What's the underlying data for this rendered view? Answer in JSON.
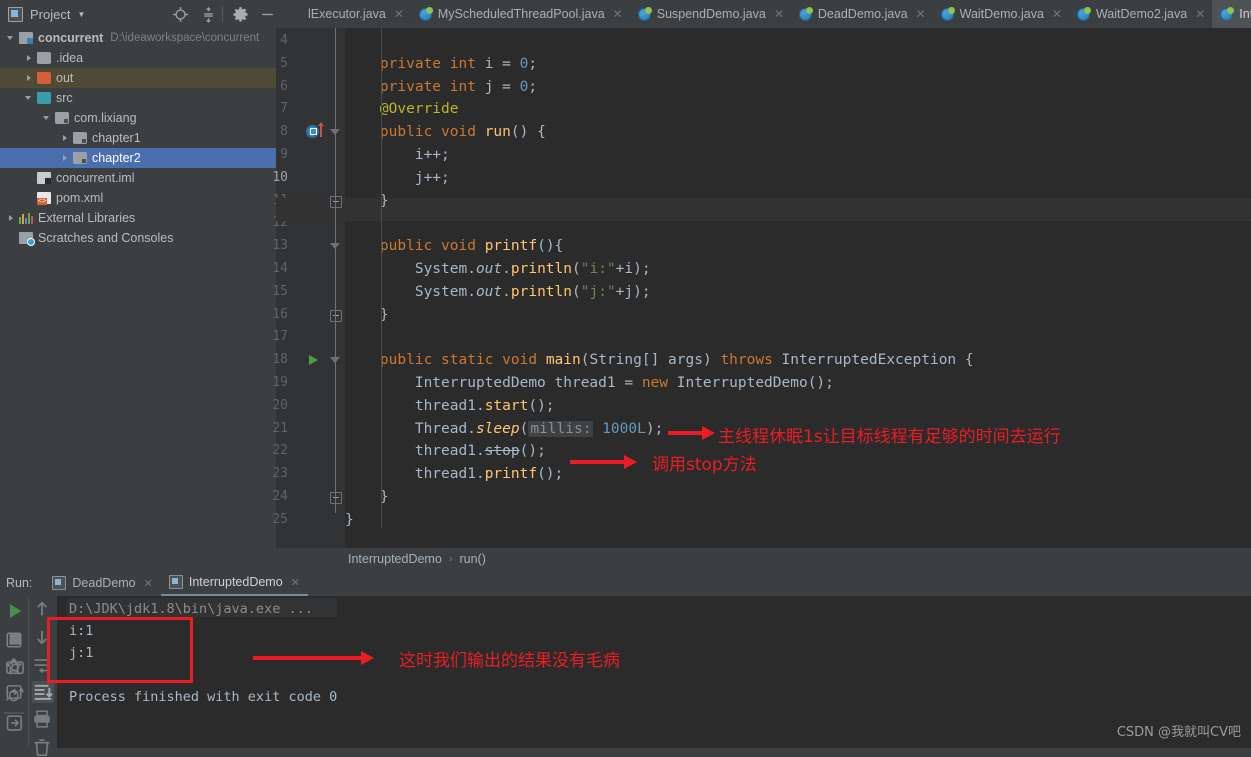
{
  "toolbar": {
    "project_label": "Project",
    "caret": "▼",
    "icons": [
      "locate-icon",
      "collapse-all-icon",
      "settings-gear-icon",
      "hide-icon"
    ]
  },
  "tabs": [
    {
      "label": "lExecutor.java",
      "active": false,
      "icon": "java-class-icon"
    },
    {
      "label": "MyScheduledThreadPool.java",
      "active": false,
      "icon": "java-class-icon"
    },
    {
      "label": "SuspendDemo.java",
      "active": false,
      "icon": "java-class-icon"
    },
    {
      "label": "DeadDemo.java",
      "active": false,
      "icon": "java-class-icon"
    },
    {
      "label": "WaitDemo.java",
      "active": false,
      "icon": "java-class-icon"
    },
    {
      "label": "WaitDemo2.java",
      "active": false,
      "icon": "java-class-icon"
    },
    {
      "label": "Interru",
      "active": true,
      "icon": "java-class-icon"
    }
  ],
  "tree": [
    {
      "label": "concurrent",
      "path": "D:\\ideaworkspace\\concurrent",
      "indent": 0,
      "arrow": "down",
      "icon": "module-icon",
      "state": "normal",
      "bold": true
    },
    {
      "label": ".idea",
      "path": "",
      "indent": 1,
      "arrow": "right",
      "icon": "folder-gray-icon",
      "state": "normal",
      "bold": false
    },
    {
      "label": "out",
      "path": "",
      "indent": 1,
      "arrow": "right",
      "icon": "folder-orange-icon",
      "state": "hover",
      "bold": false
    },
    {
      "label": "src",
      "path": "",
      "indent": 1,
      "arrow": "down",
      "icon": "folder-teal-icon",
      "state": "normal",
      "bold": false
    },
    {
      "label": "com.lixiang",
      "path": "",
      "indent": 2,
      "arrow": "down",
      "icon": "package-icon",
      "state": "normal",
      "bold": false
    },
    {
      "label": "chapter1",
      "path": "",
      "indent": 3,
      "arrow": "right",
      "icon": "package-icon",
      "state": "normal",
      "bold": false
    },
    {
      "label": "chapter2",
      "path": "",
      "indent": 3,
      "arrow": "right",
      "icon": "package-icon",
      "state": "selected",
      "bold": false
    },
    {
      "label": "concurrent.iml",
      "path": "",
      "indent": 1,
      "arrow": "none",
      "icon": "iml-file-icon",
      "state": "normal",
      "bold": false
    },
    {
      "label": "pom.xml",
      "path": "",
      "indent": 1,
      "arrow": "none",
      "icon": "xml-file-icon",
      "state": "normal",
      "bold": false
    },
    {
      "label": "External Libraries",
      "path": "",
      "indent": 0,
      "arrow": "right",
      "icon": "libraries-icon",
      "state": "normal",
      "bold": false
    },
    {
      "label": "Scratches and Consoles",
      "path": "",
      "indent": 0,
      "arrow": "none",
      "icon": "scratches-icon",
      "state": "normal",
      "bold": false
    }
  ],
  "editor": {
    "current_line": 10,
    "first_line": 4,
    "lines": [
      {
        "n": 4,
        "text": ""
      },
      {
        "n": 5,
        "text": "    private int i = 0;"
      },
      {
        "n": 6,
        "text": "    private int j = 0;"
      },
      {
        "n": 7,
        "text": "    @Override"
      },
      {
        "n": 8,
        "text": "    public void run() {"
      },
      {
        "n": 9,
        "text": "        i++;"
      },
      {
        "n": 10,
        "text": "        j++;"
      },
      {
        "n": 11,
        "text": "    }"
      },
      {
        "n": 12,
        "text": ""
      },
      {
        "n": 13,
        "text": "    public void printf(){"
      },
      {
        "n": 14,
        "text": "        System.out.println(\"i:\"+i);"
      },
      {
        "n": 15,
        "text": "        System.out.println(\"j:\"+j);"
      },
      {
        "n": 16,
        "text": "    }"
      },
      {
        "n": 17,
        "text": ""
      },
      {
        "n": 18,
        "text": "    public static void main(String[] args) throws InterruptedException {"
      },
      {
        "n": 19,
        "text": "        InterruptedDemo thread1 = new InterruptedDemo();"
      },
      {
        "n": 20,
        "text": "        thread1.start();"
      },
      {
        "n": 21,
        "text": "        Thread.sleep( millis: 1000L);"
      },
      {
        "n": 22,
        "text": "        thread1.stop();"
      },
      {
        "n": 23,
        "text": "        thread1.printf();"
      },
      {
        "n": 24,
        "text": "    }"
      },
      {
        "n": 25,
        "text": "}"
      }
    ],
    "param_hint": "millis:",
    "breadcrumb": {
      "class": "InterruptedDemo",
      "separator": "›",
      "method": "run()"
    }
  },
  "annotations": [
    {
      "name": "annotation-sleep",
      "text": "主线程休眠"
    },
    {
      "name": "annotation-sleep-full",
      "text": "主线程休眠1s让目标线程有足够的时间去运行"
    },
    {
      "name": "annotation-stop",
      "text": "调用stop方法"
    },
    {
      "name": "annotation-output",
      "text": "这时我们输出的结果没有毛病"
    }
  ],
  "run_panel": {
    "run_label": "Run:",
    "tabs": [
      {
        "label": "DeadDemo",
        "active": false
      },
      {
        "label": "InterruptedDemo",
        "active": true
      }
    ],
    "console_lines": [
      {
        "text": "D:\\JDK\\jdk1.8\\bin\\java.exe ...",
        "dim": true
      },
      {
        "text": "i:1",
        "dim": false
      },
      {
        "text": "j:1",
        "dim": false
      },
      {
        "text": "",
        "dim": false
      },
      {
        "text": "Process finished with exit code 0",
        "dim": false
      }
    ],
    "sidebar_icons": [
      "rerun-icon",
      "stop-icon",
      "screenshot-icon",
      "debug-attach-icon",
      "export-icon",
      "scroll-up-icon",
      "scroll-down-icon",
      "soft-wrap-icon",
      "scroll-to-end-icon",
      "print-icon",
      "trash-icon"
    ]
  },
  "watermark": "CSDN @我就叫CV吧",
  "colors": {
    "bg_panel": "#3c3f41",
    "bg_editor": "#2b2b2b",
    "accent_selection": "#4b6eaf",
    "annotation_red": "#ec1c24",
    "keyword": "#cc7832",
    "number": "#6897bb",
    "string": "#6a8759",
    "method": "#ffc66d",
    "annotation_java": "#bbb529",
    "text": "#a9b7c6"
  }
}
